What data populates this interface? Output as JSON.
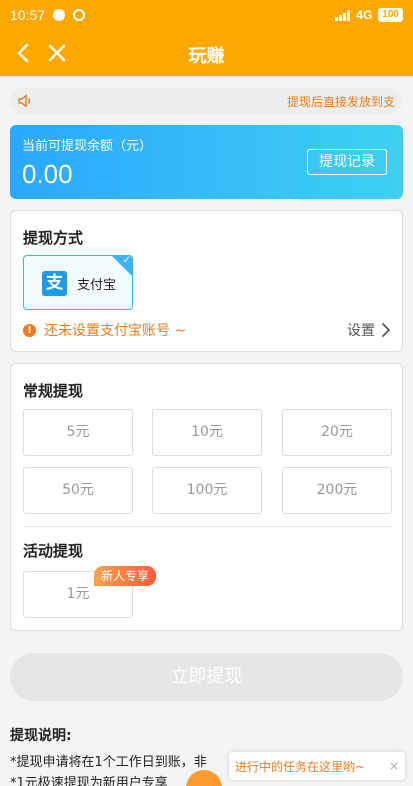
{
  "status_bar": {
    "time": "10:57",
    "network": "4G",
    "battery": "100"
  },
  "nav": {
    "title": "玩赚"
  },
  "notice": {
    "text": "提现后直接发放到支"
  },
  "balance": {
    "label": "当前可提现余额（元）",
    "amount": "0.00",
    "record_button": "提现记录"
  },
  "method": {
    "title": "提现方式",
    "option_name": "支付宝",
    "option_logo": "支",
    "warning": "还未设置支付宝账号 ~",
    "setup_link": "设置"
  },
  "regular": {
    "title": "常规提现",
    "amounts": [
      "5元",
      "10元",
      "20元",
      "50元",
      "100元",
      "200元"
    ]
  },
  "activity": {
    "title": "活动提现",
    "amounts": [
      "1元"
    ],
    "badge": "新人专享"
  },
  "submit_button": "立即提现",
  "explain": {
    "title": "提现说明:",
    "lines": [
      "*提现申请将在1个工作日到账，非",
      "*1元极速提现为新用户专享"
    ]
  },
  "floating_tip": {
    "text": "进行中的任务在这里哟~",
    "close": "×"
  },
  "colors": {
    "brand": "#ffa800",
    "accent_blue": "#2aa8ff",
    "warning": "#f07b1d",
    "alipay": "#1b9bea"
  }
}
